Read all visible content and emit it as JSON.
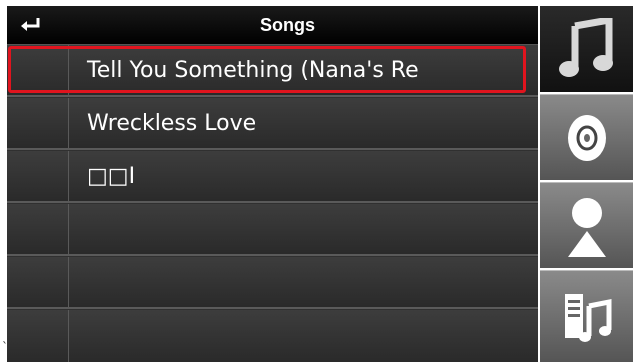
{
  "header": {
    "title": "Songs",
    "back_icon": "back-arrow-icon"
  },
  "songs": [
    {
      "title": "Tell You Something (Nana's Re"
    },
    {
      "title": "Wreckless Love"
    },
    {
      "title": "□□I"
    },
    {
      "title": ""
    },
    {
      "title": ""
    },
    {
      "title": ""
    }
  ],
  "selected_index": 0,
  "side_tabs": [
    {
      "name": "songs",
      "icon": "music-note-icon",
      "active": true
    },
    {
      "name": "albums",
      "icon": "disc-icon",
      "active": false
    },
    {
      "name": "artists",
      "icon": "person-icon",
      "active": false
    },
    {
      "name": "playlists",
      "icon": "playlist-icon",
      "active": false
    }
  ],
  "colors": {
    "highlight": "#e0141e",
    "panel": "#303030",
    "header": "#000000"
  },
  "stray_mark": "`"
}
